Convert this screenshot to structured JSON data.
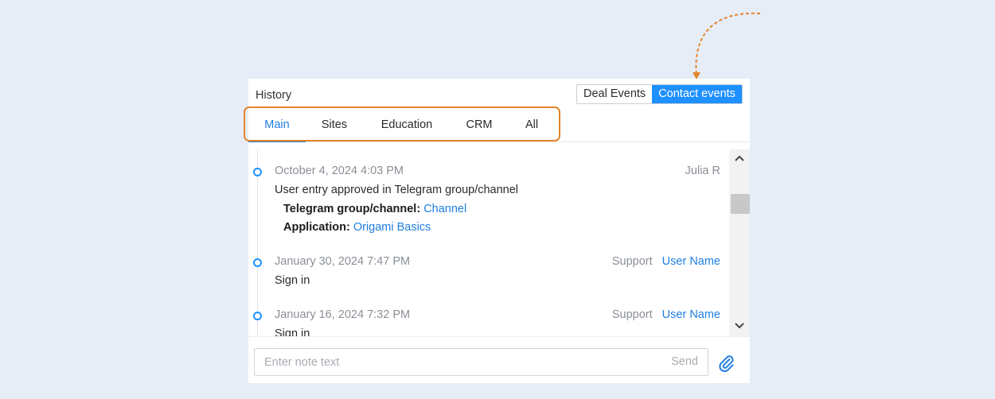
{
  "panel": {
    "title": "History",
    "event_toggle": {
      "deal_events": "Deal Events",
      "contact_events": "Contact events",
      "active": "contact_events"
    },
    "tabs": [
      {
        "label": "Main",
        "active": true
      },
      {
        "label": "Sites",
        "active": false
      },
      {
        "label": "Education",
        "active": false
      },
      {
        "label": "CRM",
        "active": false
      },
      {
        "label": "All",
        "active": false
      }
    ]
  },
  "entries": [
    {
      "date": "October 4, 2024 4:03 PM",
      "author_role": "",
      "author_name": "Julia R",
      "message": "User entry approved in Telegram group/channel",
      "details": [
        {
          "label": "Telegram group/channel:",
          "value": "Channel"
        },
        {
          "label": "Application:",
          "value": "Origami Basics"
        }
      ]
    },
    {
      "date": "January 30, 2024 7:47 PM",
      "author_role": "Support",
      "author_name": "User Name",
      "message": "Sign in"
    },
    {
      "date": "January 16, 2024 7:32 PM",
      "author_role": "Support",
      "author_name": "User Name",
      "message": "Sign in"
    }
  ],
  "note": {
    "placeholder": "Enter note text",
    "value": "",
    "send_label": "Send"
  },
  "colors": {
    "accent": "#1e90ff",
    "link": "#1e7fe0",
    "highlight": "#e2852c",
    "background": "#e6edf7"
  },
  "icons": {
    "scroll_up": "chevron-up-icon",
    "scroll_down": "chevron-down-icon",
    "attach": "paperclip-icon",
    "timeline_dot": "timeline-dot-icon"
  }
}
